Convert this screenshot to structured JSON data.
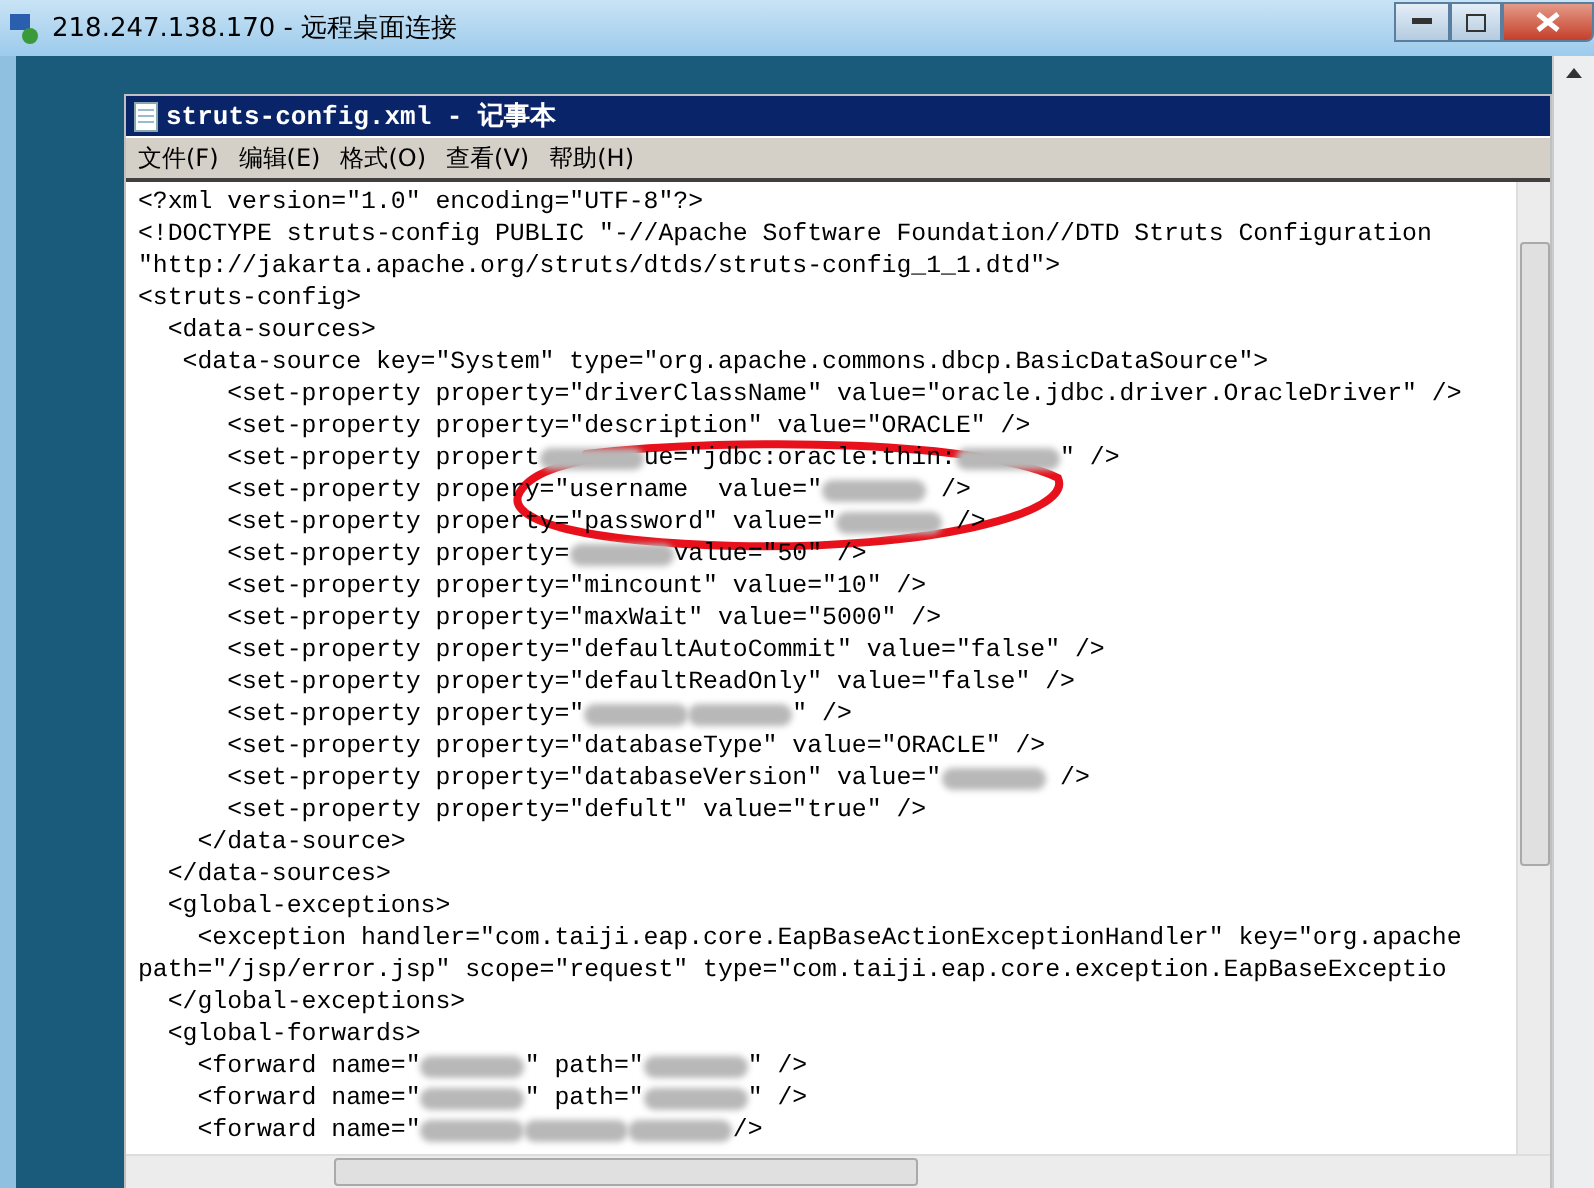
{
  "remote_window": {
    "title": "218.247.138.170 - 远程桌面连接"
  },
  "notepad": {
    "title": "struts-config.xml - 记事本",
    "menu": [
      "文件(F)",
      "编辑(E)",
      "格式(O)",
      "查看(V)",
      "帮助(H)"
    ],
    "lines": [
      [
        {
          "kind": "text",
          "text": "<?xml version=\"1.0\" encoding=\"UTF-8\"?>"
        }
      ],
      [
        {
          "kind": "text",
          "text": "<!DOCTYPE struts-config PUBLIC \"-//Apache Software Foundation//DTD Struts Configuration"
        }
      ],
      [
        {
          "kind": "text",
          "text": "\"http://jakarta.apache.org/struts/dtds/struts-config_1_1.dtd\">"
        }
      ],
      [
        {
          "kind": "text",
          "text": "<struts-config>"
        }
      ],
      [
        {
          "kind": "text",
          "text": "  <data-sources>"
        }
      ],
      [
        {
          "kind": "text",
          "text": "   <data-source key=\"System\" type=\"org.apache.commons.dbcp.BasicDataSource\">"
        }
      ],
      [
        {
          "kind": "text",
          "text": "      <set-property property=\"driverClassName\" value=\"oracle.jdbc.driver.OracleDriver\" />"
        }
      ],
      [
        {
          "kind": "text",
          "text": "      <set-property property=\"description\" value=\"ORACLE\" />"
        }
      ],
      [
        {
          "kind": "text",
          "text": "      <set-property propert"
        },
        {
          "kind": "blur"
        },
        {
          "kind": "text",
          "text": "ue=\"jdbc:oracle:thin:"
        },
        {
          "kind": "blur"
        },
        {
          "kind": "text",
          "text": "\" />"
        }
      ],
      [
        {
          "kind": "text",
          "text": "      <set-property proper"
        },
        {
          "kind": "text",
          "text": "y=\"username  value=\""
        },
        {
          "kind": "blur"
        },
        {
          "kind": "text",
          "text": " />"
        }
      ],
      [
        {
          "kind": "text",
          "text": "      <set-property property=\"password\" value=\""
        },
        {
          "kind": "blur"
        },
        {
          "kind": "text",
          "text": " />"
        }
      ],
      [
        {
          "kind": "text",
          "text": "      <set-property property="
        },
        {
          "kind": "blur"
        },
        {
          "kind": "text",
          "text": "value=\"50\" />"
        }
      ],
      [
        {
          "kind": "text",
          "text": "      <set-property property=\"mincount\" value=\"10\" />"
        }
      ],
      [
        {
          "kind": "text",
          "text": "      <set-property property=\"maxWait\" value=\"5000\" />"
        }
      ],
      [
        {
          "kind": "text",
          "text": "      <set-property property=\"defaultAutoCommit\" value=\"false\" />"
        }
      ],
      [
        {
          "kind": "text",
          "text": "      <set-property property=\"defaultReadOnly\" value=\"false\" />"
        }
      ],
      [
        {
          "kind": "text",
          "text": "      <set-property property=\""
        },
        {
          "kind": "blur"
        },
        {
          "kind": "blur"
        },
        {
          "kind": "text",
          "text": "\" />"
        }
      ],
      [
        {
          "kind": "text",
          "text": "      <set-property property=\"databaseType\" value=\"ORACLE\" />"
        }
      ],
      [
        {
          "kind": "text",
          "text": "      <set-property property=\"databaseVersion\" value=\""
        },
        {
          "kind": "blur"
        },
        {
          "kind": "text",
          "text": " />"
        }
      ],
      [
        {
          "kind": "text",
          "text": "      <set-property property=\"defult\" value=\"true\" />"
        }
      ],
      [
        {
          "kind": "text",
          "text": "    </data-source>"
        }
      ],
      [
        {
          "kind": "text",
          "text": "  </data-sources>"
        }
      ],
      [
        {
          "kind": "text",
          "text": "  <global-exceptions>"
        }
      ],
      [
        {
          "kind": "text",
          "text": "    <exception handler=\"com.taiji.eap.core.EapBaseActionExceptionHandler\" key=\"org.apache"
        }
      ],
      [
        {
          "kind": "text",
          "text": "path=\"/jsp/error.jsp\" scope=\"request\" type=\"com.taiji.eap.core.exception.EapBaseExceptio"
        }
      ],
      [
        {
          "kind": "text",
          "text": "  </global-exceptions>"
        }
      ],
      [
        {
          "kind": "text",
          "text": "  <global-forwards>"
        }
      ],
      [
        {
          "kind": "text",
          "text": "    <forward name=\""
        },
        {
          "kind": "blur"
        },
        {
          "kind": "text",
          "text": "\" path=\""
        },
        {
          "kind": "blur"
        },
        {
          "kind": "text",
          "text": "\" />"
        }
      ],
      [
        {
          "kind": "text",
          "text": "    <forward name=\""
        },
        {
          "kind": "blur"
        },
        {
          "kind": "text",
          "text": "\" path=\""
        },
        {
          "kind": "blur"
        },
        {
          "kind": "text",
          "text": "\" />"
        }
      ],
      [
        {
          "kind": "text",
          "text": "    <forward name=\""
        },
        {
          "kind": "blur"
        },
        {
          "kind": "blur"
        },
        {
          "kind": "blur"
        },
        {
          "kind": "text",
          "text": "/>"
        }
      ]
    ]
  }
}
